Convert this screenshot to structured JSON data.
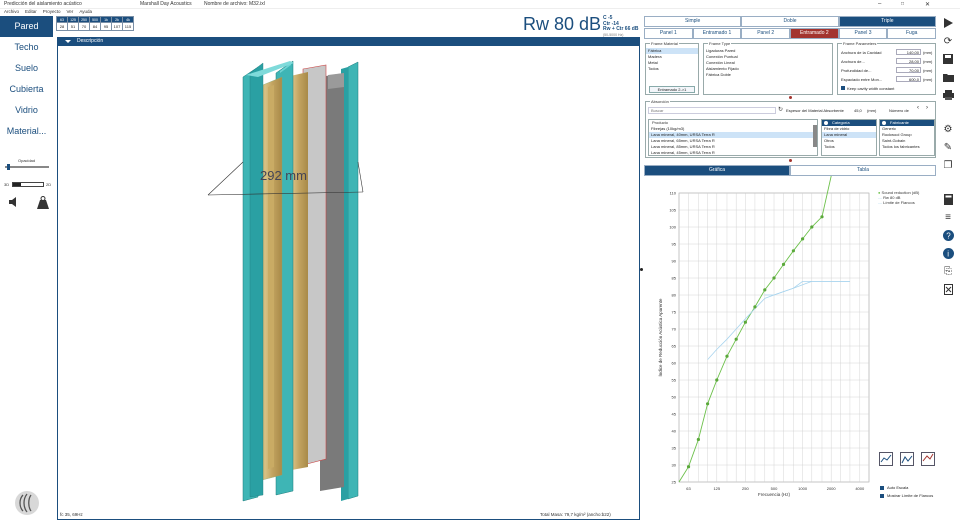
{
  "window": {
    "title": "Predicción del aislamiento acústico",
    "company": "Marshall Day Acoustics",
    "filename": "Nombre de archivo: M32.ixl"
  },
  "menu": [
    "Archivo",
    "Editar",
    "Proyecto",
    "Ver",
    "Ayuda"
  ],
  "bands": {
    "headers": [
      "63",
      "125",
      "250",
      "500",
      "1k",
      "2k",
      "4k"
    ],
    "values": [
      "28",
      "51",
      "70",
      "84",
      "95",
      "107",
      "115"
    ]
  },
  "rating": {
    "main": "Rw 80 dB",
    "c": "C -5",
    "ctr": "Ctr -14",
    "rwctr": "Rw + Ctr 66 dB",
    "range": "(50-5000 Hz)"
  },
  "nav": {
    "items": [
      "Pared",
      "Techo",
      "Suelo",
      "Cubierta",
      "Vidrio",
      "Material..."
    ],
    "opacity_label": "Opacidad",
    "view_3d": "3D",
    "view_2d": "2D"
  },
  "viewport": {
    "header": "Descripción",
    "dimension": "292 mm",
    "footer_left": "fc 35, 69Hz",
    "footer_right": "Total Masa: 79,7 kg/m² (ancho:b22)"
  },
  "mode_tabs": [
    "Simple",
    "Doble",
    "Triple"
  ],
  "layer_tabs": [
    "Panel 1",
    "Entramado 1",
    "Panel 2",
    "Entramado 2",
    "Panel 3",
    "Fuga"
  ],
  "frame_material": {
    "title": "Frame Material",
    "items": [
      "Fábrica",
      "Madera",
      "Metal",
      "Todos"
    ],
    "button": "Entramado 2->1"
  },
  "frame_type": {
    "title": "Frame Type",
    "items": [
      "Ligaduras Pared",
      "Conexión Puntual",
      "Conexión Lineal",
      "Aislamiento Fijado",
      "Fábrica Doble"
    ]
  },
  "frame_params": {
    "title": "Frame Parameters",
    "rows": [
      {
        "label": "Anchura de la Cavidad",
        "value": "140,00",
        "unit": "(mm)"
      },
      {
        "label": "Anchura de...",
        "value": "28,00",
        "unit": "(mm)"
      },
      {
        "label": "Profundidad de...",
        "value": "70,00",
        "unit": "(mm)"
      },
      {
        "label": "Espaciado entre Mon...",
        "value": "600,0",
        "unit": "(mm)"
      }
    ],
    "checkbox": "Keep cavity width constant"
  },
  "absorption": {
    "title": "Absorción",
    "search_placeholder": "Buscar",
    "thickness_label": "Espesor del Material Absorbente",
    "thickness_value": "45,0",
    "thickness_unit": "(mm)",
    "number_label": "Número de",
    "product_title": "Producto",
    "products": [
      "Fibrejas (10kg/m3)",
      "Lana mineral, 40mm, URSA Terra R",
      "Lana mineral, 65mm, URSA Terra R",
      "Lana mineral, 85mm, URSA Terra R",
      "Lana mineral, 45mm, URSA Terra R"
    ],
    "category_title": "Categoría",
    "categories": [
      "Fibra de vidrio",
      "Lana mineral",
      "Otros",
      "Todos"
    ],
    "maker_title": "Fabricante",
    "makers": [
      "Generic",
      "Rockwool Group",
      "Saint-Gobain",
      "Todos los fabricantes"
    ]
  },
  "result_tabs": [
    "Gráfica",
    "Tabla"
  ],
  "chart_data": {
    "type": "line",
    "ylabel": "Índice de Reducción Acústica Aparente",
    "xlabel": "Frecuencia (Hz)",
    "x_ticks": [
      "63",
      "125",
      "250",
      "500",
      "1000",
      "2000",
      "4000"
    ],
    "ylim": [
      25,
      110
    ],
    "y_ticks": [
      25,
      30,
      35,
      40,
      45,
      50,
      55,
      60,
      65,
      70,
      75,
      80,
      85,
      90,
      95,
      100,
      105,
      110
    ],
    "grid": true,
    "legend_position": "top-right",
    "series": [
      {
        "name": "Sound reduction (dB)",
        "color": "#6cc04a",
        "x": [
          50,
          63,
          80,
          100,
          125,
          160,
          200,
          250,
          315,
          400,
          500,
          630,
          800,
          1000,
          1250,
          1600,
          2000
        ],
        "values": [
          25,
          29.5,
          37.5,
          48,
          55,
          62,
          67,
          72,
          76.5,
          81.5,
          85,
          89,
          93,
          96.5,
          100,
          103,
          115
        ]
      },
      {
        "name": "Rw 80 dB",
        "color": "#a8d4ee",
        "x": [
          100,
          125,
          160,
          200,
          250,
          315,
          400,
          500,
          630,
          800,
          1000,
          1250,
          1600,
          2000,
          2500,
          3150
        ],
        "values": [
          61,
          64,
          67,
          70,
          73,
          76,
          79,
          80,
          81,
          82,
          83,
          84,
          84,
          84,
          84,
          84
        ]
      },
      {
        "name": "Límite de Flancos",
        "color": "#a8d4ee",
        "x": [
          400,
          500,
          630,
          800,
          1000,
          1250,
          1600,
          2000,
          2500,
          3150
        ],
        "values": [
          80,
          80,
          81,
          82,
          84,
          84,
          84,
          84,
          84,
          84
        ]
      }
    ]
  },
  "chart_options": {
    "auto_scale": "Auto Escala",
    "show_limit": "Mostrar Límite de Flancos"
  }
}
